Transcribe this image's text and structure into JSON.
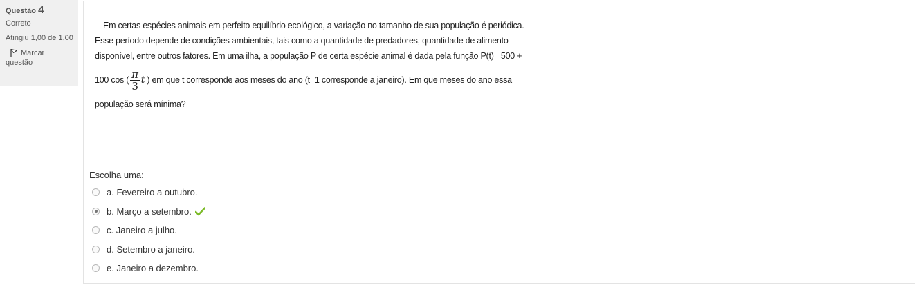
{
  "question_info": {
    "label": "Questão",
    "number": "4",
    "state": "Correto",
    "grade": "Atingiu 1,00 de 1,00",
    "flag_label": "Marcar",
    "flag_label_2": "questão"
  },
  "question_text": {
    "line1": "Em certas espécies animais em perfeito equilíbrio ecológico, a variação no tamanho de sua população é periódica.",
    "line2": "Esse período depende de condições ambientais, tais como a quantidade de predadores, quantidade de alimento",
    "line3": "disponível, entre outros fatores. Em uma ilha, a população P de certa espécie animal é dada pela função P(t)= 500 +",
    "formula_prefix": "100 cos (",
    "fraction_numerator": "π",
    "fraction_denominator": "3",
    "formula_variable": "t",
    "formula_suffix": ") em que t corresponde aos meses do ano (t=1 corresponde a janeiro). Em que meses do ano essa",
    "line5": "população será mínima?"
  },
  "prompt": "Escolha uma:",
  "answers": [
    {
      "label": "a. Fevereiro a outubro.",
      "selected": false
    },
    {
      "label": "b. Março a setembro.",
      "selected": true,
      "correct": true
    },
    {
      "label": "c. Janeiro a julho.",
      "selected": false
    },
    {
      "label": "d. Setembro a janeiro.",
      "selected": false
    },
    {
      "label": "e. Janeiro a dezembro.",
      "selected": false
    }
  ],
  "colors": {
    "correct_check": "#7dbb2a",
    "info_background": "#f0f0f0"
  }
}
